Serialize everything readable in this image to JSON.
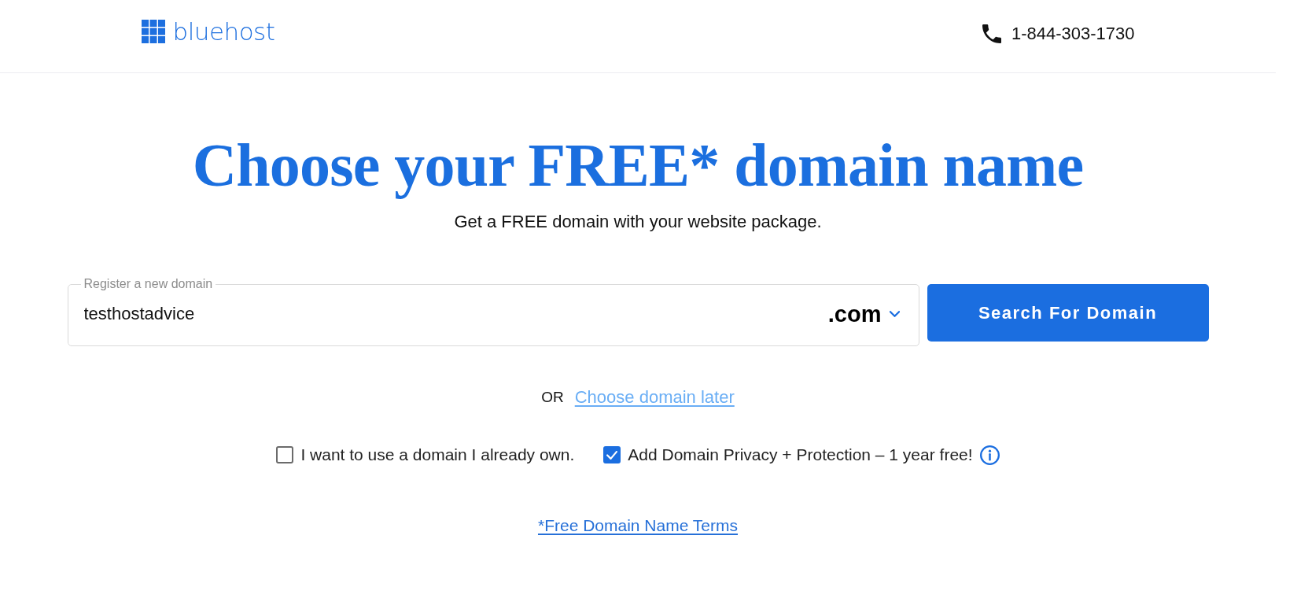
{
  "header": {
    "logo": "bluehost",
    "phone": "1-844-303-1730"
  },
  "hero": {
    "title": "Choose your FREE* domain name",
    "subtitle": "Get a FREE domain with your website package."
  },
  "domain_search": {
    "label": "Register a new domain",
    "value": "testhostadvice",
    "tld": ".com",
    "button": "Search For Domain"
  },
  "alternative": {
    "prefix": "OR",
    "link": "Choose domain later"
  },
  "options": [
    {
      "label": "I want to use a domain I already own.",
      "checked": false,
      "info": false
    },
    {
      "label": "Add Domain Privacy + Protection – 1 year free!",
      "checked": true,
      "info": true
    }
  ],
  "terms_link": "*Free Domain Name Terms"
}
